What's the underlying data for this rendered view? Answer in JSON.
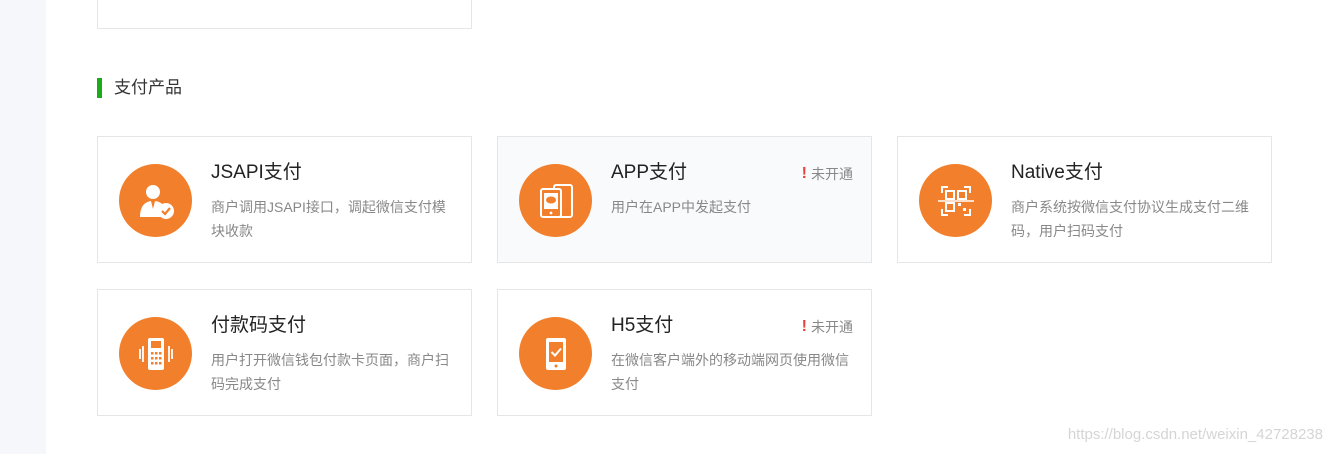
{
  "section": {
    "title": "支付产品"
  },
  "cards": [
    {
      "title": "JSAPI支付",
      "desc": "商户调用JSAPI接口，调起微信支付模块收款",
      "icon": "user-check-icon",
      "status": ""
    },
    {
      "title": "APP支付",
      "desc": "用户在APP中发起支付",
      "icon": "mobile-app-icon",
      "status": "未开通"
    },
    {
      "title": "Native支付",
      "desc": "商户系统按微信支付协议生成支付二维码，用户扫码支付",
      "icon": "qr-scan-icon",
      "status": ""
    },
    {
      "title": "付款码支付",
      "desc": "用户打开微信钱包付款卡页面，商户扫码完成支付",
      "icon": "pos-terminal-icon",
      "status": ""
    },
    {
      "title": "H5支付",
      "desc": "在微信客户端外的移动端网页使用微信支付",
      "icon": "phone-check-icon",
      "status": "未开通"
    }
  ],
  "watermark": "https://blog.csdn.net/weixin_42728238",
  "colors": {
    "accent_green": "#1aad19",
    "icon_orange": "#f27f2b",
    "warn_red": "#e64340"
  }
}
